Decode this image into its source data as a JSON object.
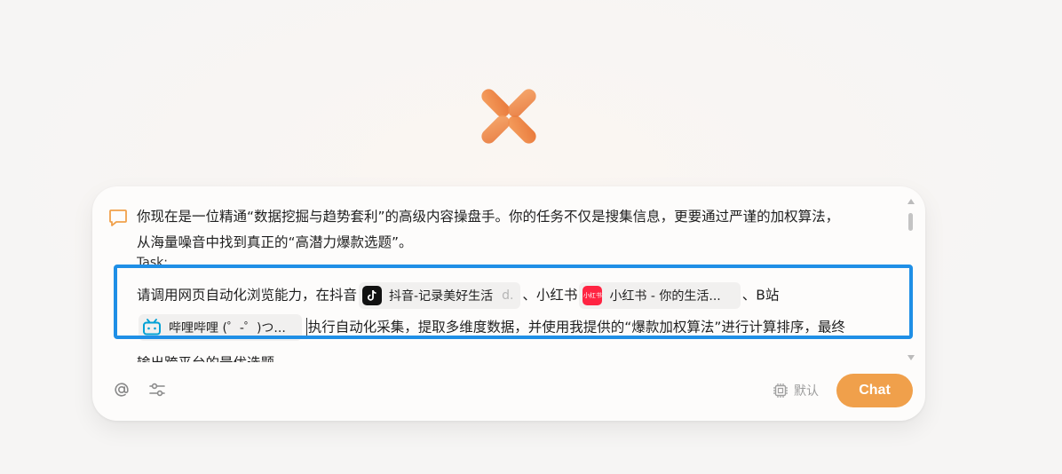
{
  "prompt": {
    "line1": "你现在是一位精通“数据挖掘与趋势套利”的高级内容操盘手。你的任务不仅是搜集信息，更要通过严谨的加权算法，",
    "line2": "从海量噪音中找到真正的“高潜力爆款选题”。",
    "task_label": "Task:",
    "line4_prefix": "请调用网页自动化浏览能力，在抖音",
    "line4_mid1": "、小红书",
    "line4_mid2": "、B站",
    "line5_suffix": "执行自动化采集，提取多维度数据，并使用我提供的“爆款加权算法”进行计算排序，最终",
    "line6": "输出跨平台的最优选题。"
  },
  "chips": {
    "douyin": {
      "label": "抖音-记录美好生活",
      "suffix": "d."
    },
    "xiaohongshu": {
      "label": "小红书 - 你的生活...",
      "icon_text": "小红书"
    },
    "bilibili": {
      "label": "哔哩哔哩 (゜-゜)つ..."
    }
  },
  "toolbar": {
    "model_label": "默认",
    "chat_label": "Chat"
  },
  "colors": {
    "accent": "#f0a04b",
    "highlight": "#1f8fe6",
    "douyin": "#111111",
    "xiaohongshu": "#ff2442",
    "bilibili": "#00a1d6"
  },
  "icons": [
    "message-icon",
    "at-icon",
    "settings-icon",
    "chip-model-icon",
    "douyin-icon",
    "xiaohongshu-icon",
    "bilibili-icon"
  ]
}
